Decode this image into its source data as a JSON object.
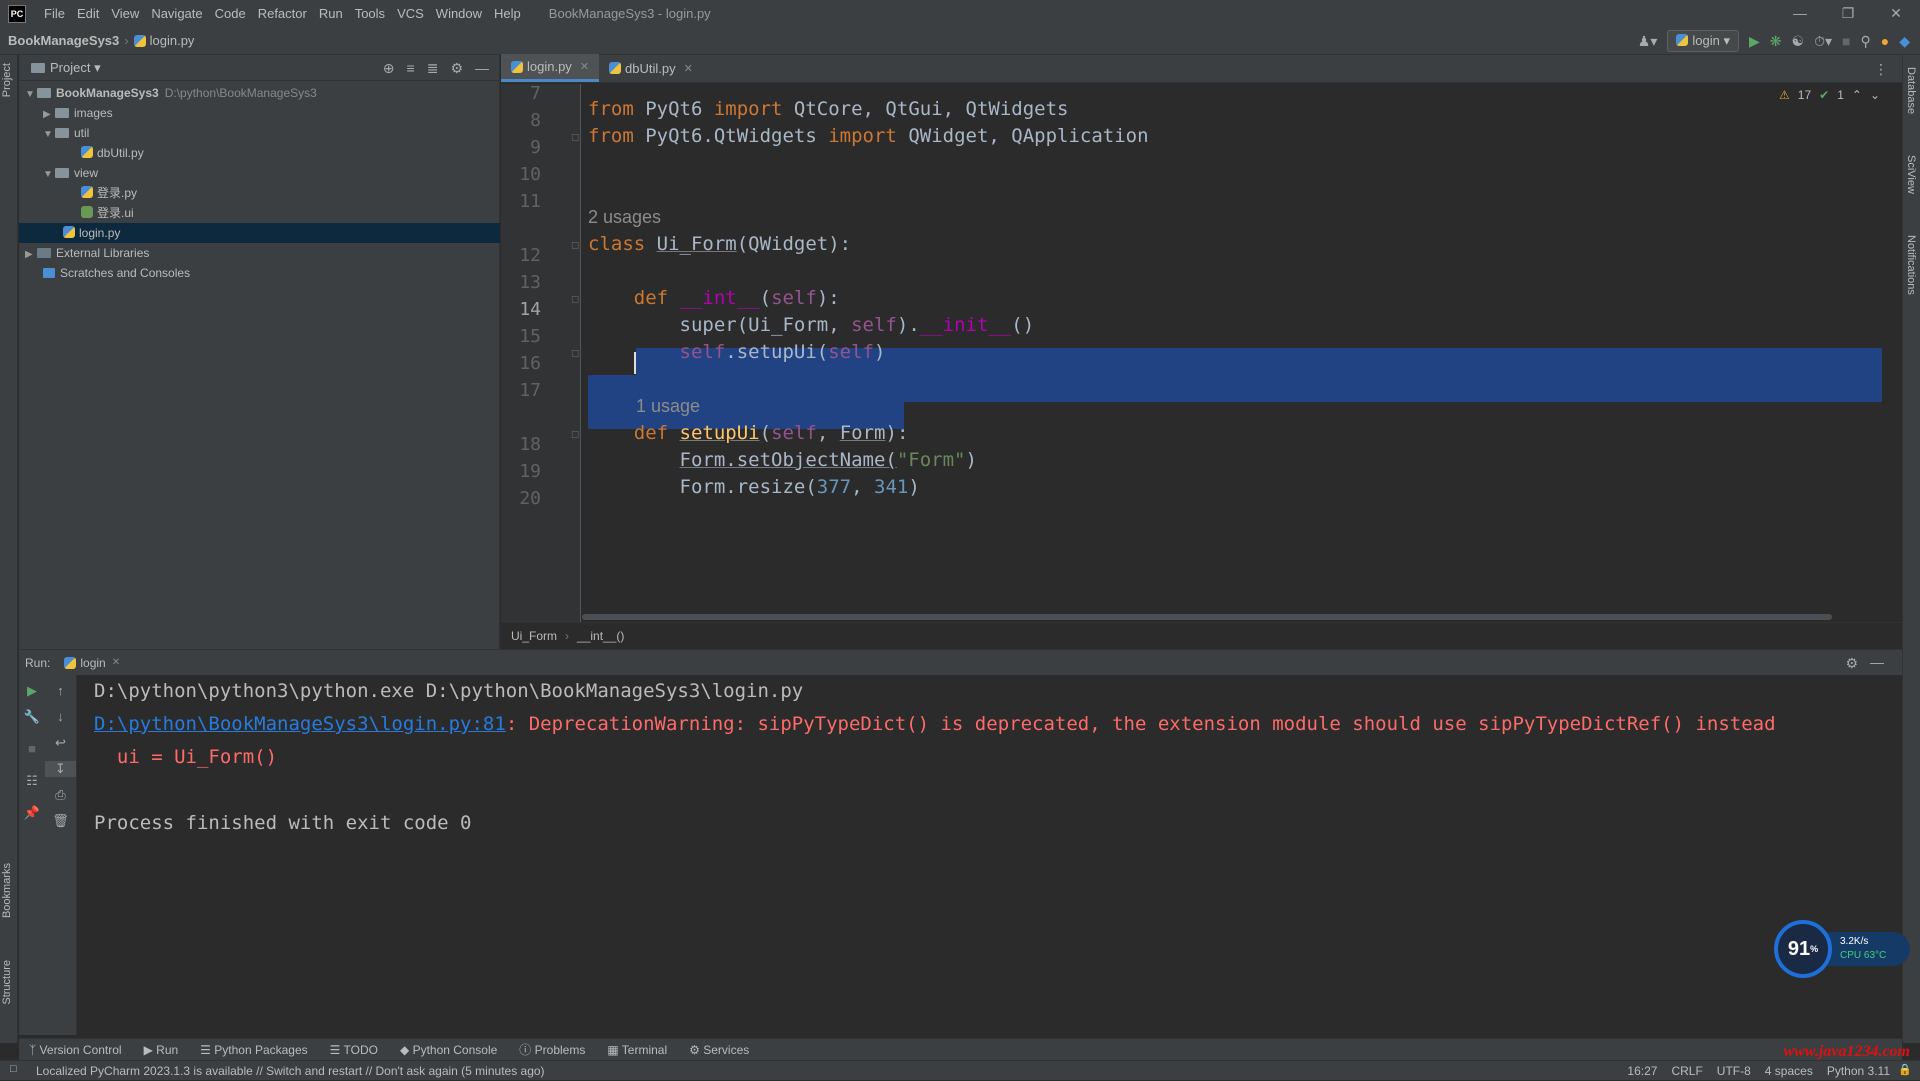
{
  "titlebar": {
    "logo": "PC",
    "menu": [
      "File",
      "Edit",
      "View",
      "Navigate",
      "Code",
      "Refactor",
      "Run",
      "Tools",
      "VCS",
      "Window",
      "Help"
    ],
    "window_title": "BookManageSys3 - login.py"
  },
  "navbar": {
    "project": "BookManageSys3",
    "file": "login.py",
    "run_config": "login"
  },
  "left_strip": {
    "top": "Project",
    "bookmarks": "Bookmarks",
    "structure": "Structure"
  },
  "right_strip": {
    "database": "Database",
    "sciview": "SciView",
    "notifications": "Notifications"
  },
  "project_panel": {
    "title": "Project",
    "tree": [
      {
        "label": "BookManageSys3",
        "path": "D:\\python\\BookManageSys3",
        "type": "root"
      },
      {
        "label": "images",
        "type": "folder"
      },
      {
        "label": "util",
        "type": "folder"
      },
      {
        "label": "dbUtil.py",
        "type": "file"
      },
      {
        "label": "view",
        "type": "folder"
      },
      {
        "label": "登录.py",
        "type": "file"
      },
      {
        "label": "登录.ui",
        "type": "file"
      },
      {
        "label": "login.py",
        "type": "file"
      },
      {
        "label": "External Libraries",
        "type": "lib"
      },
      {
        "label": "Scratches and Consoles",
        "type": "scratch"
      }
    ]
  },
  "editor": {
    "tabs": [
      {
        "label": "login.py"
      },
      {
        "label": "dbUtil.py"
      }
    ],
    "inspections": {
      "warnings": "17",
      "ok": "1"
    },
    "line_numbers": [
      "7",
      "8",
      "9",
      "10",
      "11",
      "12",
      "13",
      "14",
      "15",
      "16",
      "17",
      "18",
      "19",
      "20"
    ],
    "hints": {
      "usages2": "2 usages",
      "usage1": "1 usage"
    },
    "code": {
      "l8": {
        "kw1": "from",
        "mod": " PyQt6 ",
        "kw2": "import",
        "rest": " QtCore, QtGui, QtWidgets"
      },
      "l9": {
        "kw1": "from",
        "mod": " PyQt6.QtWidgets ",
        "kw2": "import",
        "rest": " QWidget, QApplication"
      },
      "l12": {
        "kw": "class",
        "name": "Ui_Form",
        "rest": "(QWidget):"
      },
      "l14": {
        "kw": "def",
        "name": "__int__",
        "p1": "(",
        "self": "self",
        "p2": "):"
      },
      "l15": {
        "a": "super(Ui_Form, ",
        "self": "self",
        "b": ").",
        "mag": "__init__",
        "c": "()"
      },
      "l16": {
        "self1": "self",
        "a": ".setupUi(",
        "self2": "self",
        "b": ")"
      },
      "l18": {
        "kw": "def",
        "name": "setupUi",
        "a": "(",
        "self": "self",
        "b": ", ",
        "form": "Form",
        "c": "):"
      },
      "l19": {
        "a": "Form.setObjectName(",
        "str": "\"Form\"",
        "b": ")"
      },
      "l20": {
        "a": "Form.resize(",
        "n1": "377",
        "b": ", ",
        "n2": "341",
        "c": ")"
      }
    },
    "breadcrumb": {
      "cls": "Ui_Form",
      "fn": "__int__()"
    }
  },
  "run_panel": {
    "label": "Run:",
    "tab": "login",
    "output": {
      "cmd": "D:\\python\\python3\\python.exe D:\\python\\BookManageSys3\\login.py",
      "link": "D:\\python\\BookManageSys3\\login.py:81",
      "warning": ": DeprecationWarning: sipPyTypeDict() is deprecated, the extension module should use sipPyTypeDictRef() instead",
      "src": "  ui = Ui_Form()",
      "exit": "Process finished with exit code 0"
    }
  },
  "tool_windows": [
    "Version Control",
    "Run",
    "Python Packages",
    "TODO",
    "Python Console",
    "Problems",
    "Terminal",
    "Services"
  ],
  "statusbar": {
    "message": "Localized PyCharm 2023.1.3 is available // Switch and restart // Don't ask again (5 minutes ago)",
    "position": "16:27",
    "line_sep": "CRLF",
    "encoding": "UTF-8",
    "indent": "4 spaces",
    "interpreter": "Python 3.11"
  },
  "widget": {
    "cpu_num": "91",
    "unit": "%",
    "net": "3.2K/s",
    "cpu": "CPU 63°C"
  },
  "watermark": "www.java1234.com",
  "colors": {
    "selection": "#214283",
    "keyword": "#cc7832",
    "function": "#ffc66d",
    "error": "#ff6b68",
    "link": "#287bde"
  }
}
